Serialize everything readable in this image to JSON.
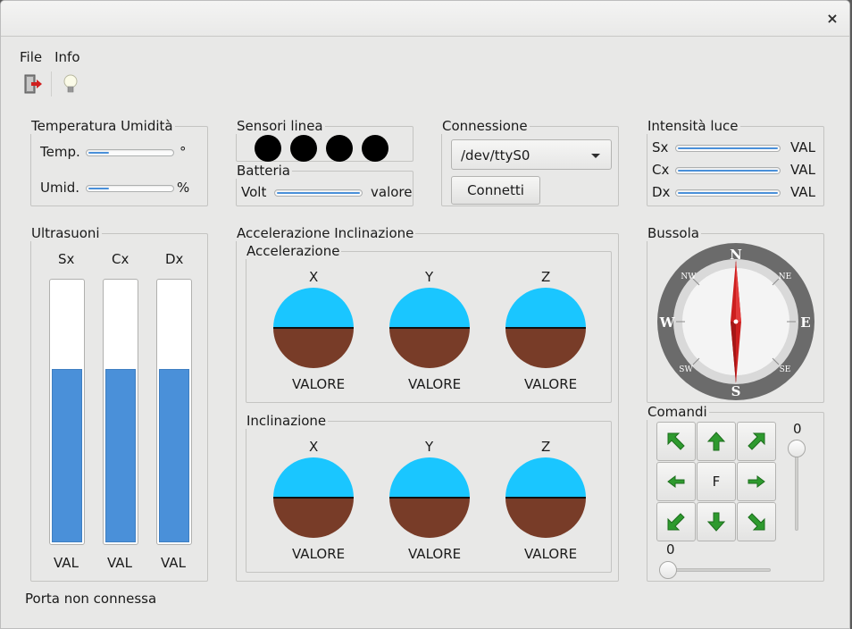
{
  "window": {
    "close_glyph": "×"
  },
  "menu": {
    "items": [
      "File",
      "Info"
    ]
  },
  "toolbar": {
    "buttons": [
      {
        "icon": "exit-icon"
      },
      {
        "icon": "lightbulb-icon"
      }
    ]
  },
  "temp_umid": {
    "title": "Temperatura Umidità",
    "temp_label": "Temp.",
    "temp_unit": "°",
    "temp_fill": 0.28,
    "umid_label": "Umid.",
    "umid_unit": "%",
    "umid_fill": 0.28
  },
  "sensori": {
    "title": "Sensori linea",
    "count": 4
  },
  "batteria": {
    "title": "Batteria",
    "label": "Volt",
    "value": "valore",
    "fill": 1.0
  },
  "connessione": {
    "title": "Connessione",
    "port": "/dev/ttyS0",
    "connect_label": "Connetti"
  },
  "luce": {
    "title": "Intensità luce",
    "rows": [
      {
        "label": "Sx",
        "value": "VAL",
        "fill": 1.0
      },
      {
        "label": "Cx",
        "value": "VAL",
        "fill": 1.0
      },
      {
        "label": "Dx",
        "value": "VAL",
        "fill": 1.0
      }
    ]
  },
  "ultrasuoni": {
    "title": "Ultrasuoni",
    "bars": [
      {
        "label": "Sx",
        "value": "VAL",
        "level": 0.67
      },
      {
        "label": "Cx",
        "value": "VAL",
        "level": 0.67
      },
      {
        "label": "Dx",
        "value": "VAL",
        "level": 0.67
      }
    ]
  },
  "accel_incl": {
    "title": "Accelerazione Inclinazione",
    "accel": {
      "title": "Accelerazione",
      "axes": [
        {
          "label": "X",
          "value": "VALORE"
        },
        {
          "label": "Y",
          "value": "VALORE"
        },
        {
          "label": "Z",
          "value": "VALORE"
        }
      ]
    },
    "incl": {
      "title": "Inclinazione",
      "axes": [
        {
          "label": "X",
          "value": "VALORE"
        },
        {
          "label": "Y",
          "value": "VALORE"
        },
        {
          "label": "Z",
          "value": "VALORE"
        }
      ]
    }
  },
  "bussola": {
    "title": "Bussola",
    "labels": {
      "n": "N",
      "s": "S",
      "e": "E",
      "w": "W",
      "ne": "NE",
      "nw": "NW",
      "se": "SE",
      "sw": "SW"
    }
  },
  "comandi": {
    "title": "Comandi",
    "center_label": "F",
    "v_slider_value": "0",
    "h_slider_value": "0"
  },
  "status": {
    "text": "Porta non connessa"
  },
  "colors": {
    "accent": "#4a90d9",
    "sky": "#1ac6ff",
    "ground": "#783c28",
    "arrow_green": "#2e9a2e",
    "needle_red": "#cc1f1f"
  }
}
